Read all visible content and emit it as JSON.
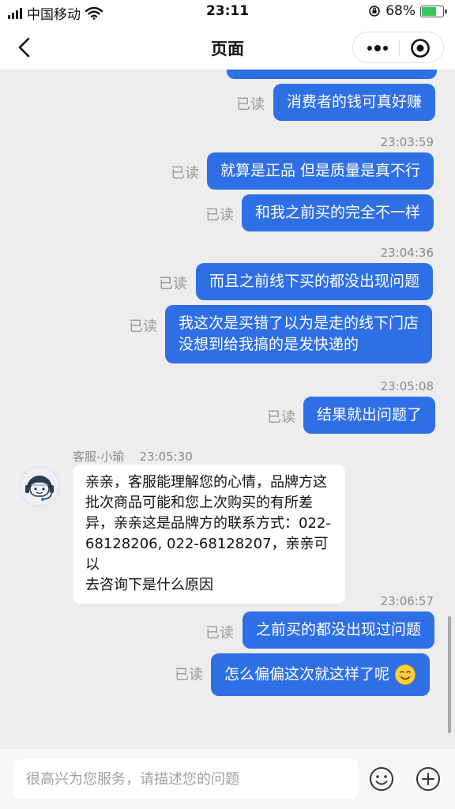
{
  "status_bar": {
    "carrier": "中国移动",
    "time": "23:11",
    "battery_percent": "68%",
    "battery_level": 0.68,
    "icons": [
      "signal-icon",
      "wifi-icon",
      "orientation-lock-icon",
      "battery-icon"
    ]
  },
  "nav": {
    "title": "页面",
    "icons": [
      "back-icon",
      "more-icon",
      "target-icon"
    ]
  },
  "messages": {
    "m0": {
      "text": ""
    },
    "m1": {
      "read": "已读",
      "text": "消费者的钱可真好赚"
    },
    "ts1": "23:03:59",
    "m2": {
      "read": "已读",
      "text": "就算是正品 但是质量是真不行"
    },
    "m3": {
      "read": "已读",
      "text": "和我之前买的完全不一样"
    },
    "ts2": "23:04:36",
    "m4": {
      "read": "已读",
      "text": "而且之前线下买的都没出现问题"
    },
    "m5": {
      "read": "已读",
      "line1": "我这次是买错了以为是走的线下门店",
      "line2": "没想到给我搞的是发快递的"
    },
    "ts3": "23:05:08",
    "m6": {
      "read": "已读",
      "text": "结果就出问题了"
    },
    "agent": {
      "name": "客服-小瑜",
      "time": "23:05:30",
      "line1": "亲亲，客服能理解您的心情，品牌方这",
      "line2": "批次商品可能和您上次购买的有所差",
      "line3": "异，亲亲这是品牌方的联系方式：022-",
      "line4": "68128206, 022-68128207，亲亲可以",
      "line5": "去咨询下是什么原因"
    },
    "ts4": "23:06:57",
    "m7": {
      "read": "已读",
      "text": "之前买的都没出现过问题"
    },
    "m8": {
      "read": "已读",
      "text": "怎么偏偏这次就这样了呢",
      "emoji": "smile-emoji-icon"
    }
  },
  "input": {
    "placeholder": "很高兴为您服务，请描述您的问题",
    "icons": [
      "emoji-icon",
      "plus-icon"
    ]
  },
  "colors": {
    "outgoing_bubble": "#2f6fe6",
    "incoming_bubble": "#ffffff",
    "background": "#ededed"
  }
}
